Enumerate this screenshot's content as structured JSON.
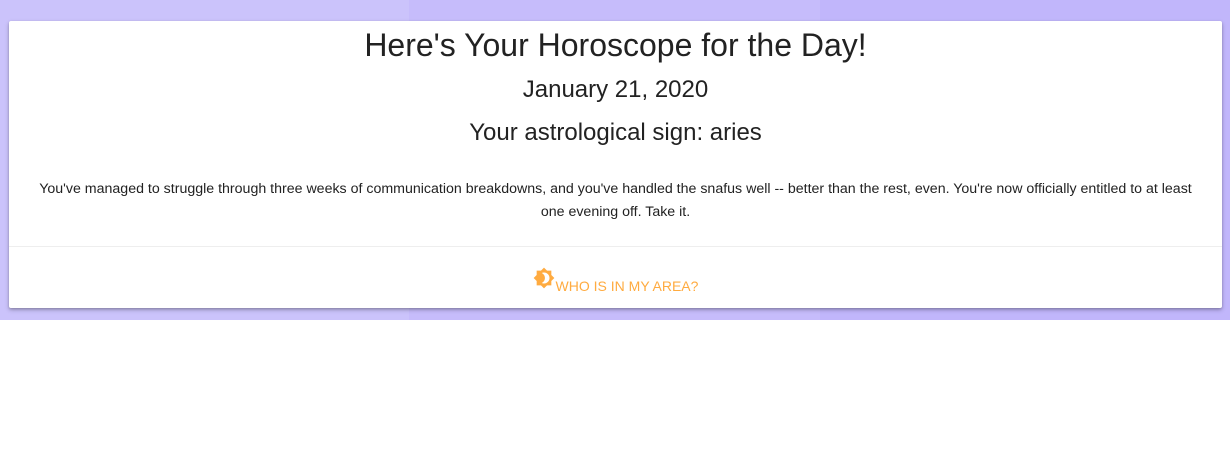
{
  "page": {
    "title": "Here's Your Horoscope for the Day!",
    "date": "January 21, 2020",
    "sign_line": "Your astrological sign: aries",
    "horoscope": "You've managed to struggle through three weeks of communication breakdowns, and you've handled the snafus well -- better than the rest, even. You're now officially entitled to at least one evening off. Take it."
  },
  "action": {
    "label": "WHO IS IN MY AREA?",
    "icon": "sun-moon-icon"
  },
  "colors": {
    "accent": "#ffab40",
    "background_band": "#c6bcfb",
    "text": "#222222"
  }
}
